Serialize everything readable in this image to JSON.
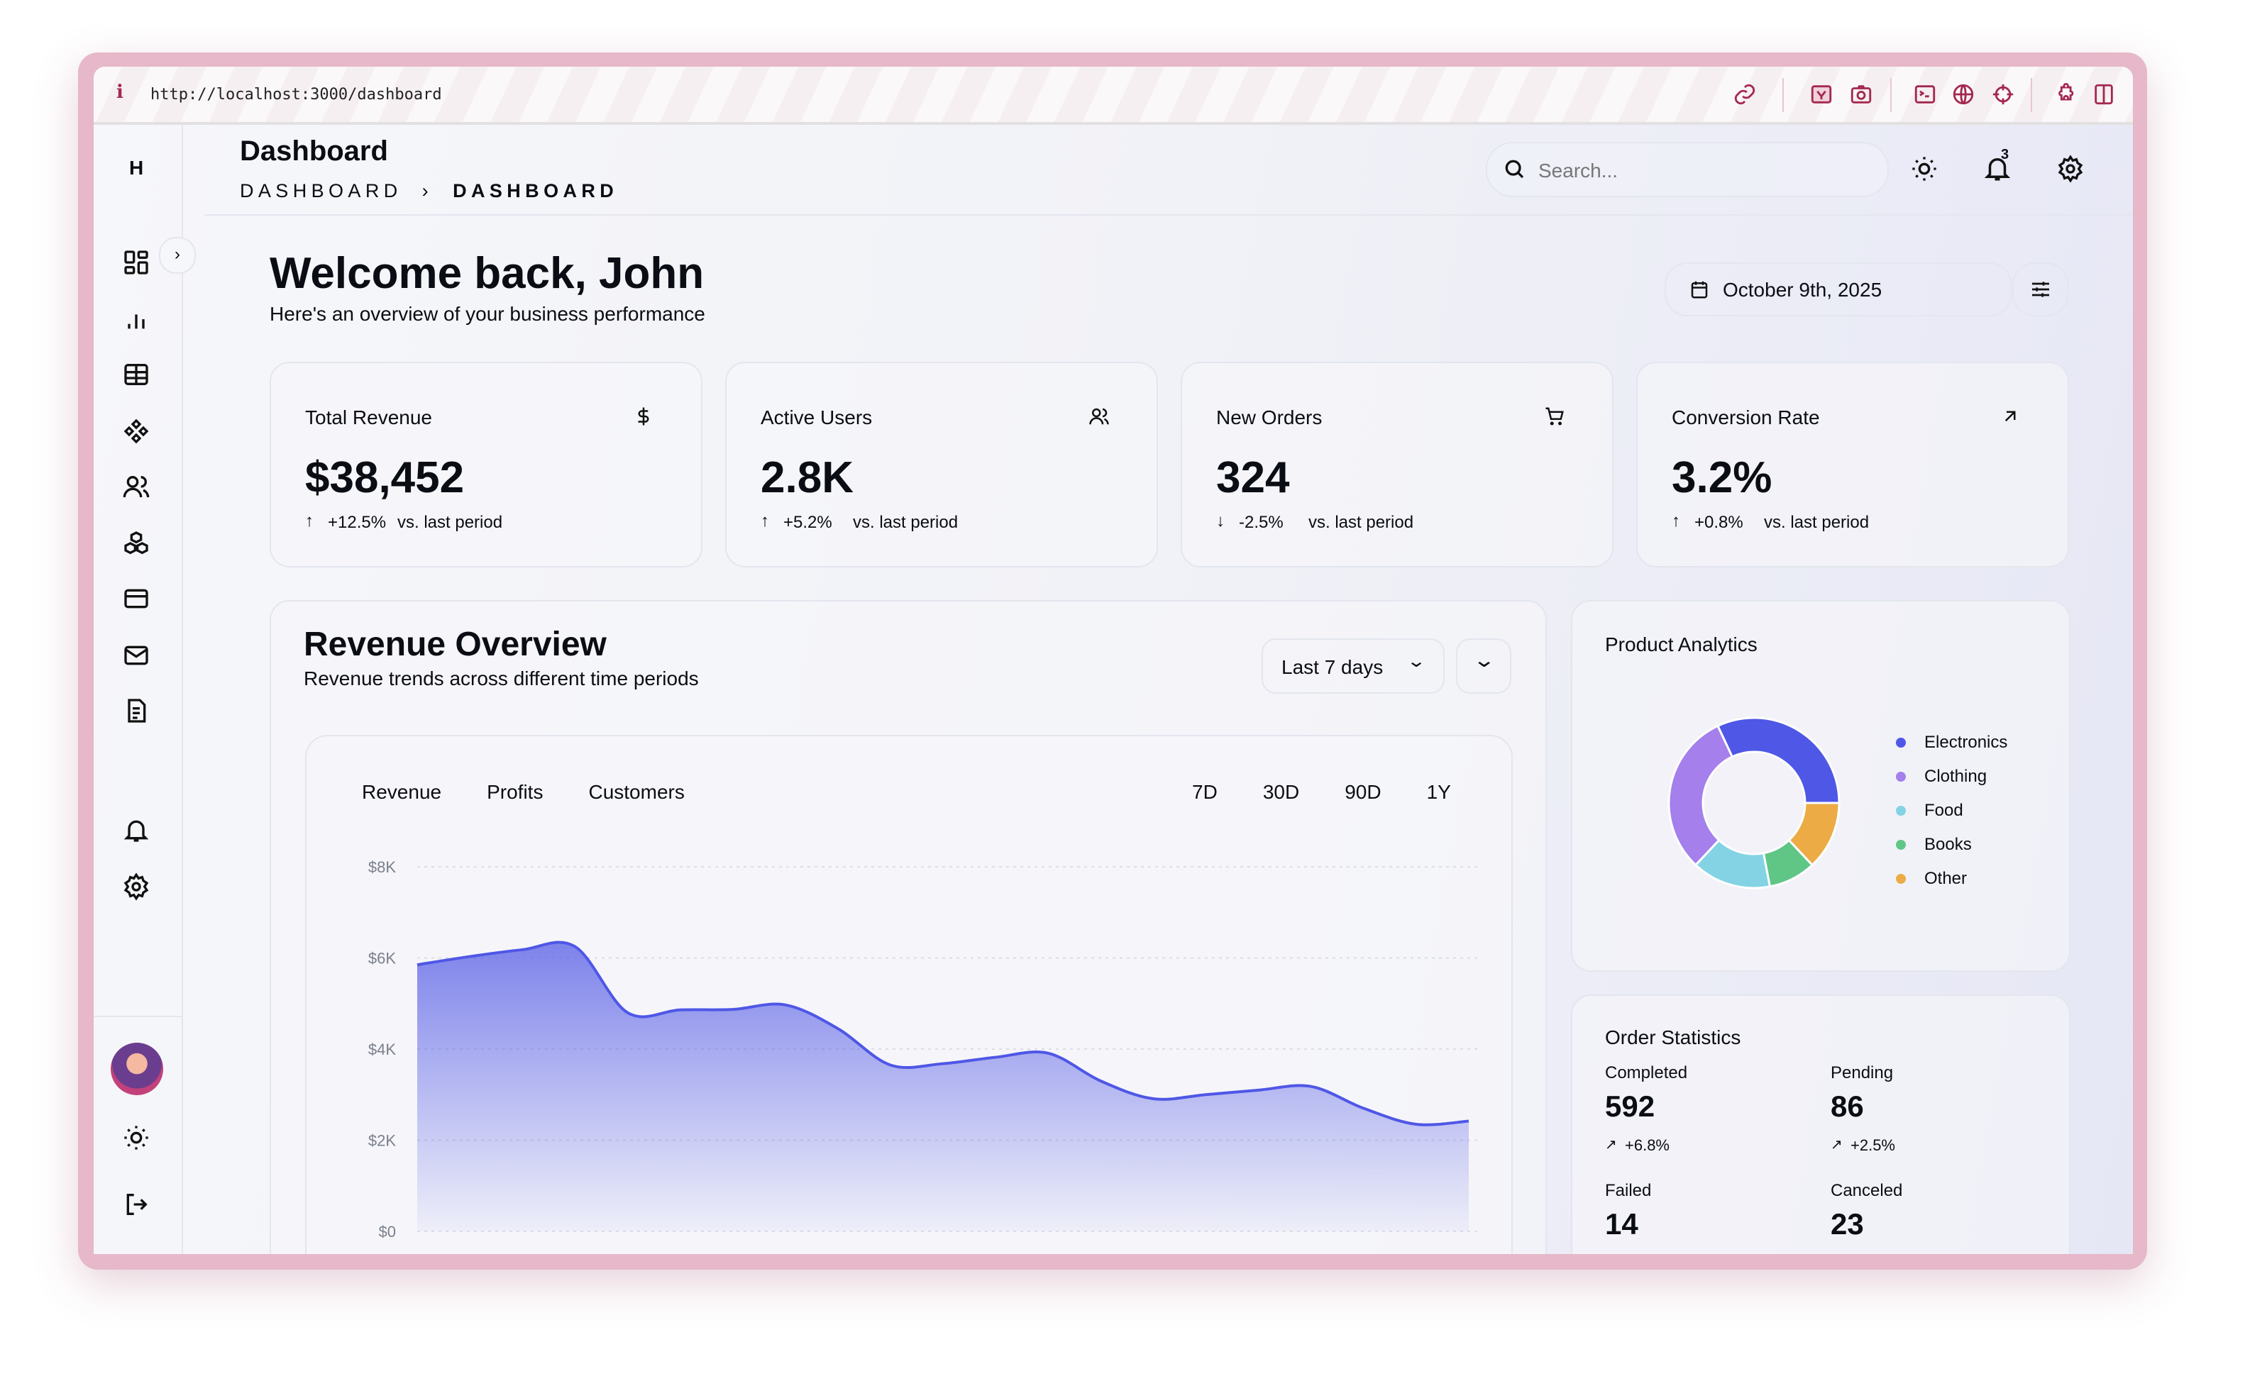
{
  "browser": {
    "url": "http://localhost:3000/dashboard",
    "icons": [
      "link-icon",
      "image-icon",
      "camera-icon",
      "terminal-icon",
      "globe-icon",
      "crosshair-icon",
      "puzzle-icon",
      "sidebar-icon"
    ],
    "accent": "#a3284f"
  },
  "sidebar": {
    "logo": "H",
    "items": [
      "dashboard-icon",
      "analytics-icon",
      "table-icon",
      "components-icon",
      "users-icon",
      "products-icon",
      "billing-icon",
      "mail-icon",
      "documents-icon",
      "notifications-icon",
      "settings-icon"
    ],
    "bottom": [
      "avatar",
      "theme-icon",
      "logout-icon"
    ]
  },
  "header": {
    "title": "Dashboard",
    "breadcrumb": [
      "DASHBOARD",
      "DASHBOARD"
    ],
    "search_placeholder": "Search...",
    "notification_count": "3"
  },
  "welcome": {
    "title": "Welcome back, John",
    "subtitle": "Here's an overview of your business performance",
    "date": "October 9th, 2025"
  },
  "stats": [
    {
      "label": "Total Revenue",
      "value": "$38,452",
      "change": "+12.5%",
      "direction": "up",
      "note": "vs. last period",
      "icon": "dollar-icon"
    },
    {
      "label": "Active Users",
      "value": "2.8K",
      "change": "+5.2%",
      "direction": "up",
      "note": "vs. last period",
      "icon": "users-icon"
    },
    {
      "label": "New Orders",
      "value": "324",
      "change": "-2.5%",
      "direction": "down",
      "note": "vs. last period",
      "icon": "cart-icon"
    },
    {
      "label": "Conversion Rate",
      "value": "3.2%",
      "change": "+0.8%",
      "direction": "up",
      "note": "vs. last period",
      "icon": "arrow-up-right-icon"
    }
  ],
  "revenue": {
    "title": "Revenue Overview",
    "subtitle": "Revenue trends across different time periods",
    "range_select": "Last 7 days",
    "tabs": [
      "Revenue",
      "Profits",
      "Customers"
    ],
    "periods": [
      "7D",
      "30D",
      "90D",
      "1Y"
    ]
  },
  "product": {
    "title": "Product Analytics"
  },
  "orders": {
    "title": "Order Statistics",
    "items": [
      {
        "label": "Completed",
        "value": "592",
        "change": "+6.8%"
      },
      {
        "label": "Pending",
        "value": "86",
        "change": "+2.5%"
      },
      {
        "label": "Failed",
        "value": "14"
      },
      {
        "label": "Canceled",
        "value": "23"
      }
    ]
  },
  "chart_data": [
    {
      "type": "area",
      "ylim": [
        0,
        8000
      ],
      "yticks": [
        "$0",
        "$2K",
        "$4K",
        "$6K",
        "$8K"
      ],
      "grid": true,
      "color": "#4f57e6",
      "series": [
        {
          "values": [
            5850,
            6030,
            6180,
            6250,
            4800,
            4860,
            4870,
            4970,
            4450,
            3650,
            3680,
            3820,
            3910,
            3300,
            2910,
            3000,
            3100,
            3180,
            2700,
            2350,
            2420
          ]
        }
      ]
    },
    {
      "type": "pie",
      "donut": true,
      "legend": "right",
      "categories": [
        "Electronics",
        "Clothing",
        "Food",
        "Books",
        "Other"
      ],
      "values": [
        32,
        31,
        15,
        9,
        13
      ],
      "colors": [
        "#4f57e6",
        "#a57fec",
        "#84d3e4",
        "#5fc686",
        "#ecab45"
      ]
    }
  ]
}
